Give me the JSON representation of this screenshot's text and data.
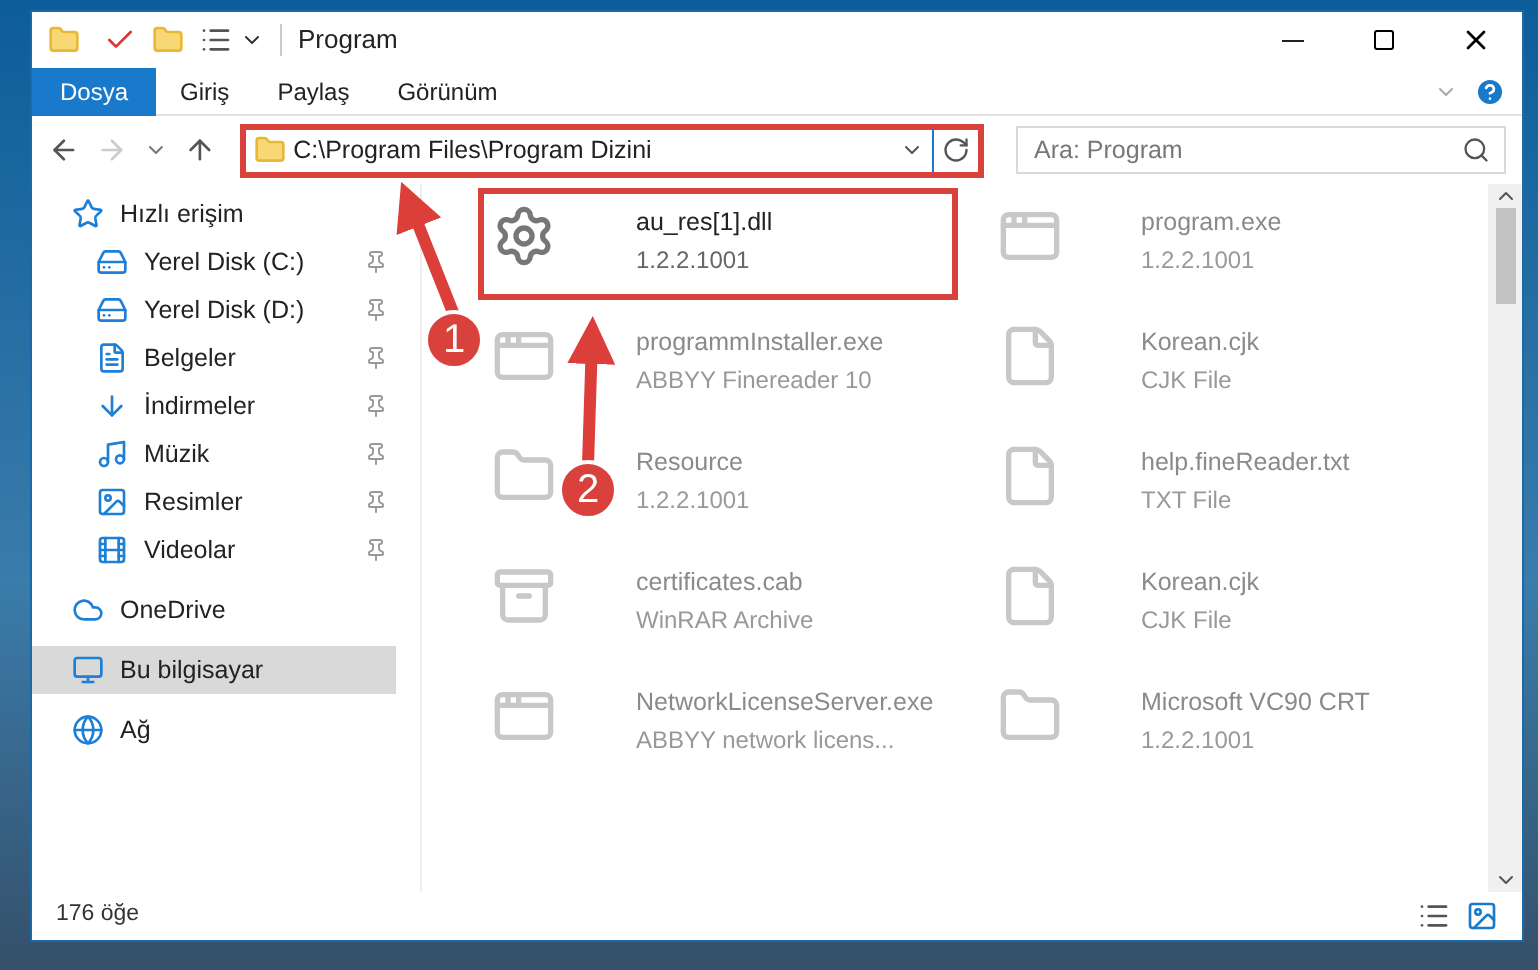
{
  "window": {
    "title": "Program"
  },
  "ribbon_tabs": [
    {
      "label": "Dosya",
      "selected": true
    },
    {
      "label": "Giriş",
      "selected": false
    },
    {
      "label": "Paylaş",
      "selected": false
    },
    {
      "label": "Görünüm",
      "selected": false
    }
  ],
  "address_bar": {
    "path": "C:\\Program Files\\Program Dizini",
    "highlighted": true
  },
  "search": {
    "placeholder": "Ara: Program"
  },
  "sidebar": {
    "items": [
      {
        "label": "Hızlı erişim",
        "selected": false,
        "pinned": false,
        "children": [
          {
            "label": "Yerel Disk (C:)",
            "selected": false,
            "pinned": true
          },
          {
            "label": "Yerel Disk (D:)",
            "selected": false,
            "pinned": true
          },
          {
            "label": "Belgeler",
            "selected": false,
            "pinned": true
          },
          {
            "label": "İndirmeler",
            "selected": false,
            "pinned": true
          },
          {
            "label": "Müzik",
            "selected": false,
            "pinned": true
          },
          {
            "label": "Resimler",
            "selected": false,
            "pinned": true
          },
          {
            "label": "Videolar",
            "selected": false,
            "pinned": true
          }
        ]
      },
      {
        "label": "OneDrive",
        "selected": false,
        "pinned": false
      },
      {
        "label": "Bu bilgisayar",
        "selected": true,
        "pinned": false
      },
      {
        "label": "Ağ",
        "selected": false,
        "pinned": false
      }
    ]
  },
  "files": [
    {
      "name": "au_res[1].dll",
      "detail": "1.2.2.1001",
      "dimmed": false,
      "highlighted": true
    },
    {
      "name": "program.exe",
      "detail": "1.2.2.1001",
      "dimmed": true,
      "highlighted": false
    },
    {
      "name": "programmInstaller.exe",
      "detail": "ABBYY Finereader 10",
      "dimmed": true,
      "highlighted": false
    },
    {
      "name": "Korean.cjk",
      "detail": "CJK File",
      "dimmed": true,
      "highlighted": false
    },
    {
      "name": "Resource",
      "detail": "1.2.2.1001",
      "dimmed": true,
      "highlighted": false
    },
    {
      "name": "help.fineReader.txt",
      "detail": "TXT File",
      "dimmed": true,
      "highlighted": false
    },
    {
      "name": "certificates.cab",
      "detail": "WinRAR Archive",
      "dimmed": true,
      "highlighted": false
    },
    {
      "name": "Korean.cjk",
      "detail": "CJK File",
      "dimmed": true,
      "highlighted": false
    },
    {
      "name": "NetworkLicenseServer.exe",
      "detail": "ABBYY network licens...",
      "dimmed": true,
      "highlighted": false
    },
    {
      "name": "Microsoft VC90 CRT",
      "detail": "1.2.2.1001",
      "dimmed": true,
      "highlighted": false
    }
  ],
  "status_bar": {
    "count": "176 öğe"
  },
  "annotations": [
    {
      "label": "1"
    },
    {
      "label": "2"
    }
  ]
}
